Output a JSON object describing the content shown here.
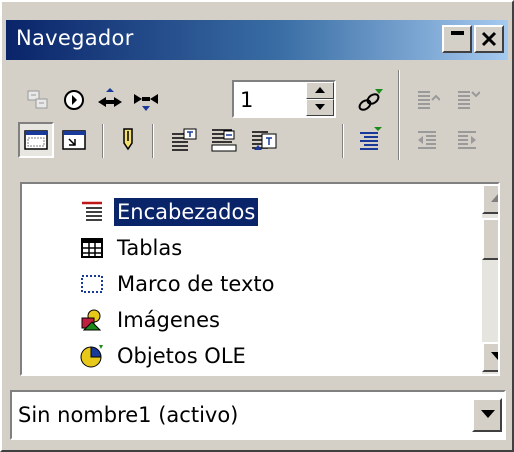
{
  "window": {
    "title": "Navegador"
  },
  "titlebar_buttons": [
    {
      "name": "minimize",
      "icon": "minimize-icon"
    },
    {
      "name": "close",
      "icon": "close-icon"
    }
  ],
  "toolbar": {
    "row1": [
      {
        "icon": "toggle-icon",
        "enabled": false
      },
      {
        "icon": "navigation-icon",
        "enabled": true
      },
      {
        "icon": "previous-icon",
        "enabled": true
      },
      {
        "icon": "next-icon",
        "enabled": true
      },
      {
        "icon": "drag-mode-icon",
        "enabled": true
      },
      {
        "icon": "promote-chapter-icon",
        "enabled": false
      },
      {
        "icon": "demote-chapter-icon",
        "enabled": false
      }
    ],
    "page_spinner": {
      "value": "1"
    },
    "row2": [
      {
        "icon": "list-box-icon",
        "enabled": true,
        "pressed": true
      },
      {
        "icon": "content-view-icon",
        "enabled": true
      },
      {
        "icon": "set-reminder-icon",
        "enabled": true
      },
      {
        "icon": "header-icon",
        "enabled": true
      },
      {
        "icon": "footer-icon",
        "enabled": true
      },
      {
        "icon": "anchor-icon",
        "enabled": true
      },
      {
        "icon": "heading-levels-icon",
        "enabled": true
      },
      {
        "icon": "promote-level-icon",
        "enabled": false
      },
      {
        "icon": "demote-level-icon",
        "enabled": false
      }
    ]
  },
  "content_list": {
    "items": [
      {
        "label": "Encabezados",
        "icon": "headings-icon",
        "selected": true
      },
      {
        "label": "Tablas",
        "icon": "table-icon",
        "selected": false
      },
      {
        "label": "Marco de texto",
        "icon": "text-frame-icon",
        "selected": false
      },
      {
        "label": "Imágenes",
        "icon": "images-icon",
        "selected": false
      },
      {
        "label": "Objetos OLE",
        "icon": "ole-objects-icon",
        "selected": false
      }
    ]
  },
  "document_selector": {
    "value": "Sin nombre1 (activo)"
  },
  "colors": {
    "titlebar_start": "#0a246a",
    "titlebar_end": "#a6caf0",
    "face": "#d4d0c8",
    "selection": "#0a246a"
  }
}
